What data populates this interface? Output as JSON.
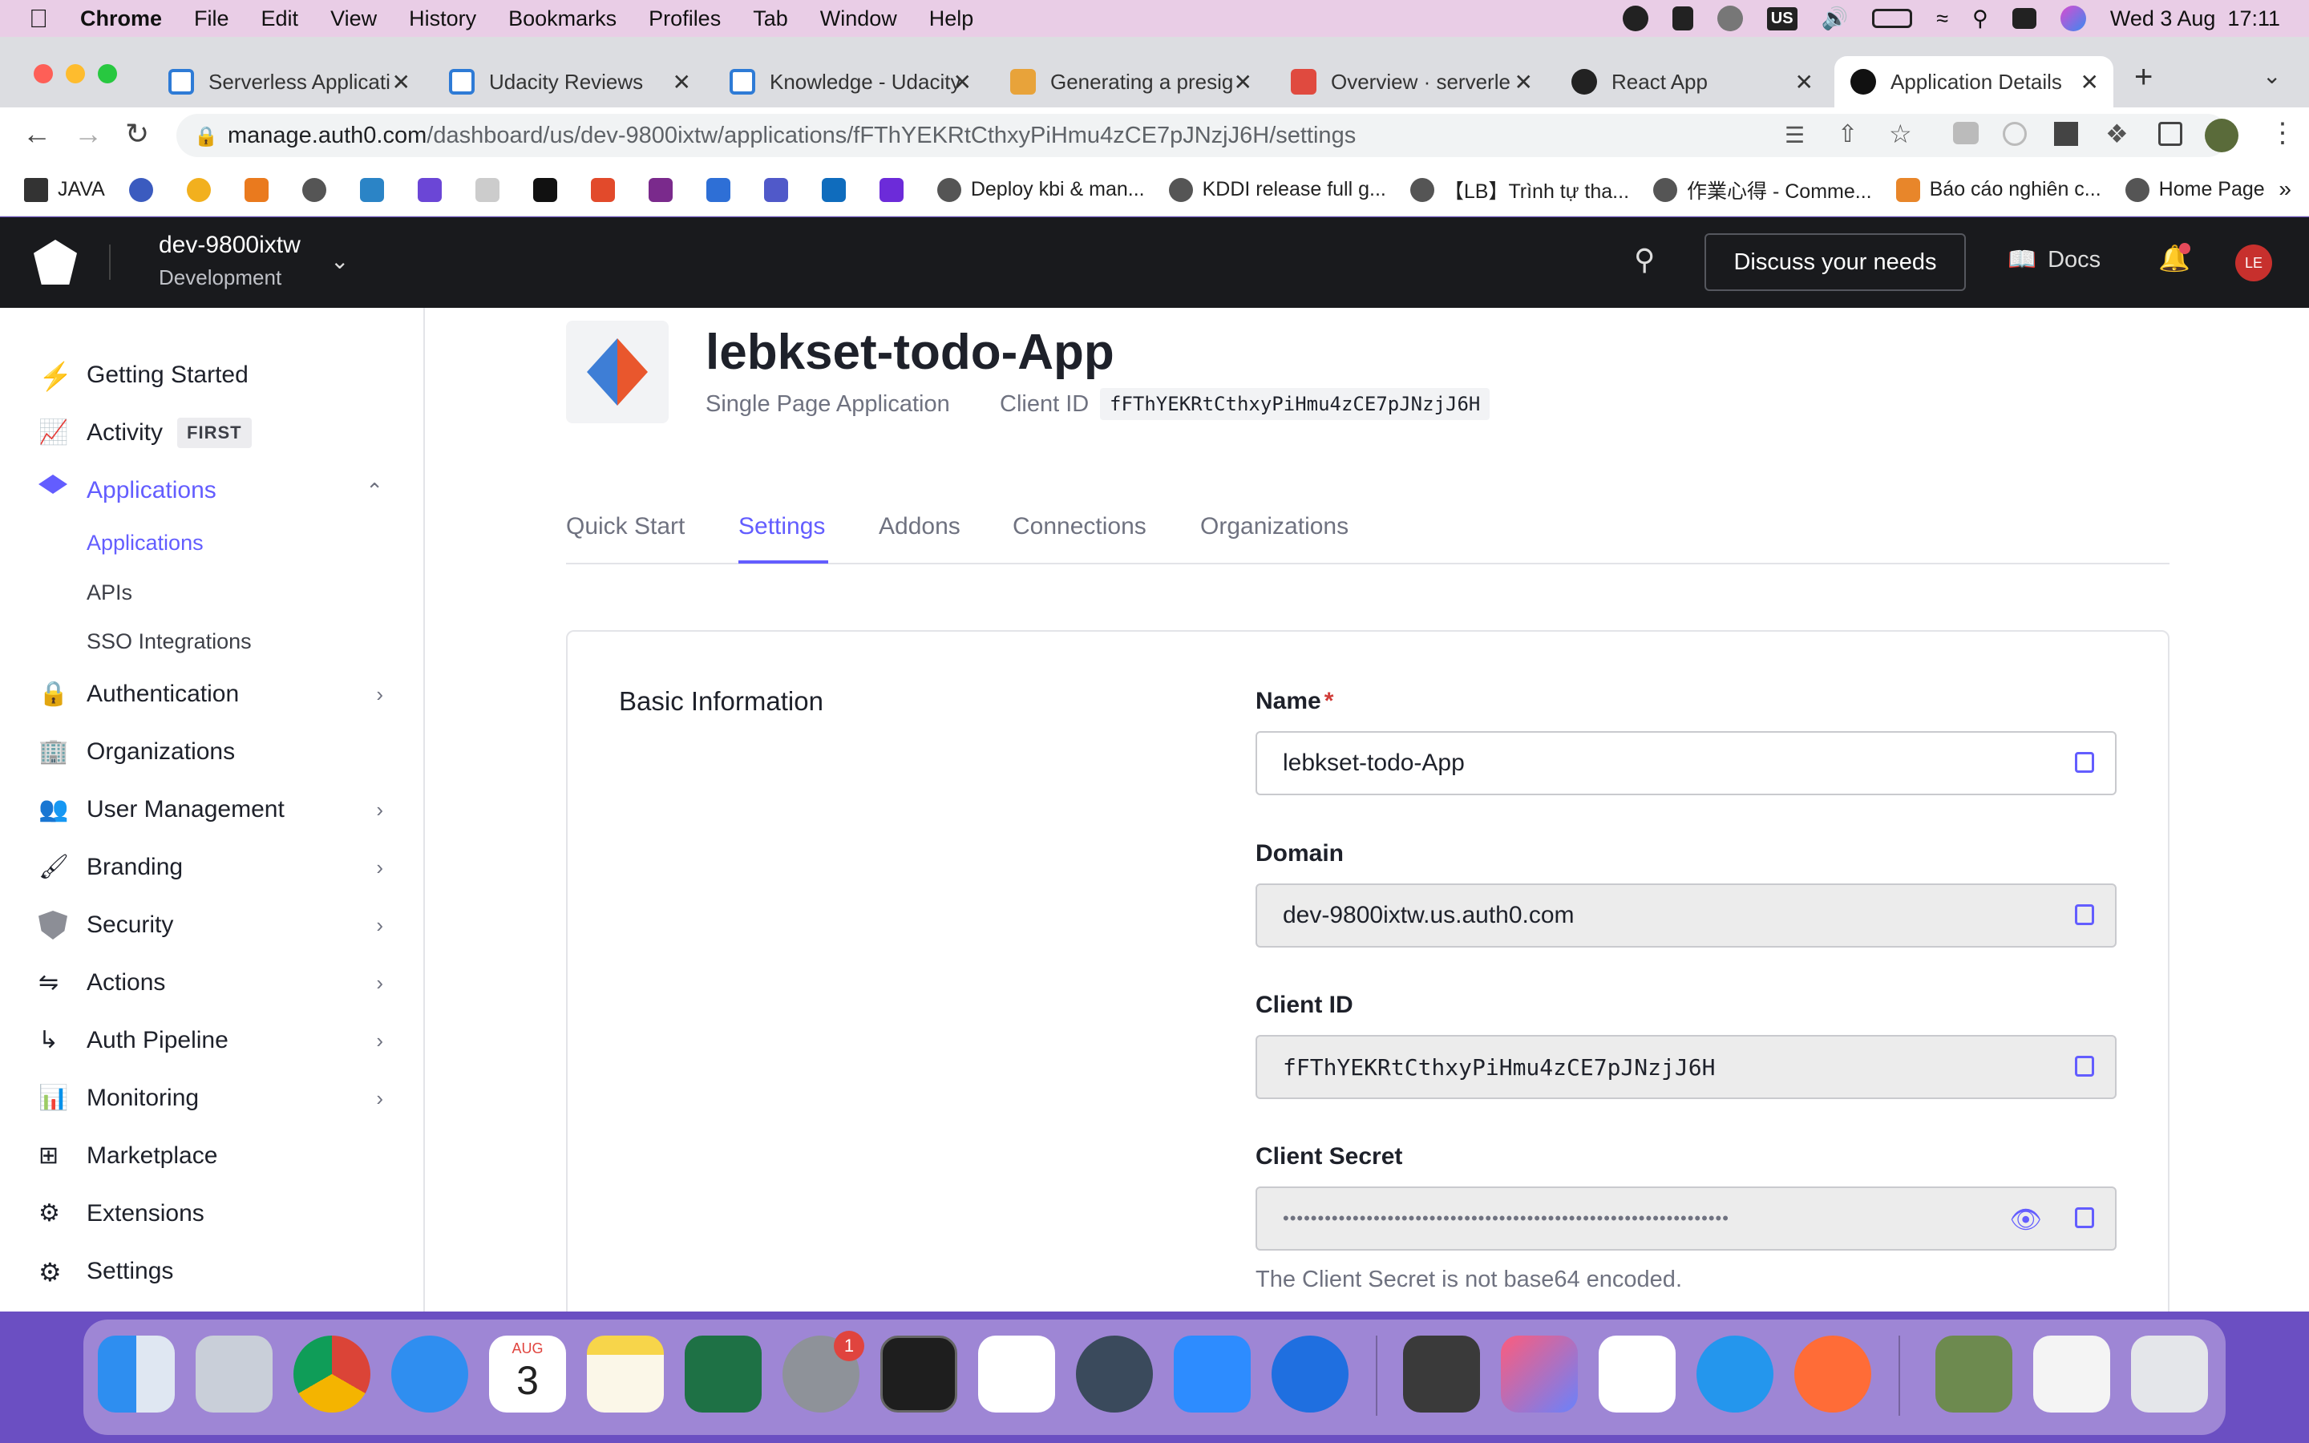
{
  "menubar": {
    "apple": "",
    "app": "Chrome",
    "items": [
      "File",
      "Edit",
      "View",
      "History",
      "Bookmarks",
      "Profiles",
      "Tab",
      "Window",
      "Help"
    ],
    "clock": "Wed 3 Aug  17:11",
    "input_source": "US"
  },
  "tabs": [
    {
      "title": "Serverless Applicati",
      "favicon": "udacity-icon",
      "color": "#2e7bd6"
    },
    {
      "title": "Udacity Reviews",
      "favicon": "udacity-icon",
      "color": "#2e7bd6"
    },
    {
      "title": "Knowledge - Udacity",
      "favicon": "udacity-icon",
      "color": "#2e7bd6"
    },
    {
      "title": "Generating a presig",
      "favicon": "aws-box-icon",
      "color": "#e8a33a"
    },
    {
      "title": "Overview · serverle",
      "favicon": "serverless-icon",
      "color": "#e04a3f"
    },
    {
      "title": "React App",
      "favicon": "react-icon",
      "color": "#222"
    },
    {
      "title": "Application Details",
      "favicon": "auth0-icon",
      "color": "#111"
    }
  ],
  "address": {
    "domain": "manage.auth0.com",
    "path": "/dashboard/us/dev-9800ixtw/applications/fFThYEKRtCthxyPiHmu4zCE7pJNzjJ6H/settings"
  },
  "bookmarks": [
    {
      "label": "JAVA",
      "icon": "folder-icon"
    },
    {
      "label": "",
      "icon": "site-icon"
    },
    {
      "label": "",
      "icon": "site-icon"
    },
    {
      "label": "",
      "icon": "site-icon"
    },
    {
      "label": "",
      "icon": "globe-icon"
    },
    {
      "label": "",
      "icon": "site-icon"
    },
    {
      "label": "",
      "icon": "site-icon"
    },
    {
      "label": "",
      "icon": "site-icon"
    },
    {
      "label": "",
      "icon": "github-icon"
    },
    {
      "label": "",
      "icon": "site-icon"
    },
    {
      "label": "",
      "icon": "site-icon"
    },
    {
      "label": "",
      "icon": "site-icon"
    },
    {
      "label": "",
      "icon": "teams-icon"
    },
    {
      "label": "",
      "icon": "outlook-icon"
    },
    {
      "label": "",
      "icon": "site-icon"
    },
    {
      "label": "Deploy kbi & man...",
      "icon": "globe-icon"
    },
    {
      "label": "KDDI release full g...",
      "icon": "globe-icon"
    },
    {
      "label": "【LB】Trình tự tha...",
      "icon": "globe-icon"
    },
    {
      "label": "作業心得 - Comme...",
      "icon": "globe-icon"
    },
    {
      "label": "Báo cáo nghiên c...",
      "icon": "box-icon"
    },
    {
      "label": "Home Page",
      "icon": "globe-icon"
    }
  ],
  "header": {
    "tenant": "dev-9800ixtw",
    "environment": "Development",
    "discuss": "Discuss your needs",
    "docs": "Docs",
    "avatar": "LE"
  },
  "sidebar": {
    "items": [
      {
        "label": "Getting Started",
        "icon": "bolt-icon"
      },
      {
        "label": "Activity",
        "icon": "activity-icon",
        "badge": "FIRST"
      },
      {
        "label": "Applications",
        "icon": "layers-icon"
      },
      {
        "label": "Authentication",
        "icon": "lock-icon"
      },
      {
        "label": "Organizations",
        "icon": "building-icon"
      },
      {
        "label": "User Management",
        "icon": "users-icon"
      },
      {
        "label": "Branding",
        "icon": "brush-icon"
      },
      {
        "label": "Security",
        "icon": "shield-icon"
      },
      {
        "label": "Actions",
        "icon": "actions-icon"
      },
      {
        "label": "Auth Pipeline",
        "icon": "pipeline-icon"
      },
      {
        "label": "Monitoring",
        "icon": "bar-chart-icon"
      },
      {
        "label": "Marketplace",
        "icon": "grid-plus-icon"
      },
      {
        "label": "Extensions",
        "icon": "puzzle-icon"
      },
      {
        "label": "Settings",
        "icon": "gear-icon"
      }
    ],
    "sub_items": [
      "Applications",
      "APIs",
      "SSO Integrations"
    ]
  },
  "app": {
    "name": "lebkset-todo-App",
    "type": "Single Page Application",
    "client_id_label": "Client ID",
    "client_id": "fFThYEKRtCthxyPiHmu4zCE7pJNzjJ6H"
  },
  "tabs_nav": [
    "Quick Start",
    "Settings",
    "Addons",
    "Connections",
    "Organizations"
  ],
  "basic": {
    "heading": "Basic Information",
    "name_label": "Name",
    "required": "*",
    "name_value": "lebkset-todo-App",
    "domain_label": "Domain",
    "domain_value": "dev-9800ixtw.us.auth0.com",
    "client_id_label": "Client ID",
    "client_id_value": "fFThYEKRtCthxyPiHmu4zCE7pJNzjJ6H",
    "secret_label": "Client Secret",
    "secret_value": "••••••••••••••••••••••••••••••••••••••••••••••••••••••••••••••••",
    "secret_hint": "The Client Secret is not base64 encoded."
  },
  "dock": {
    "calendar_month": "AUG",
    "calendar_day": "3",
    "settings_badge": "1"
  },
  "colors": {
    "accent": "#635dff",
    "header_bg": "#191a1d",
    "dock_bg": "#6b4fc2"
  }
}
